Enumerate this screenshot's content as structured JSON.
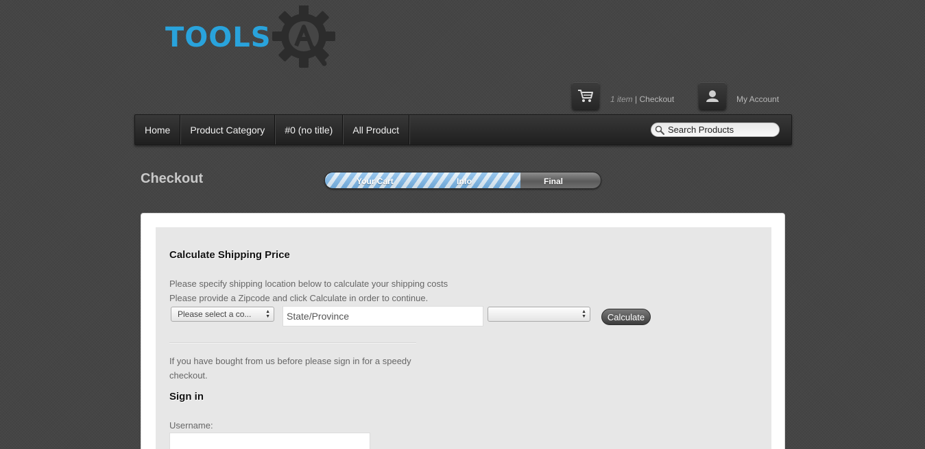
{
  "logo": {
    "text": "TOOLS",
    "badge_letter": "A"
  },
  "header": {
    "cart_count": "1 item",
    "cart_separator": " | ",
    "checkout_link": "Checkout",
    "account_link": "My Account"
  },
  "nav": {
    "items": [
      {
        "label": "Home"
      },
      {
        "label": "Product Category"
      },
      {
        "label": "#0 (no title)"
      },
      {
        "label": "All Product"
      }
    ],
    "search_placeholder": "Search Products"
  },
  "page": {
    "title": "Checkout",
    "progress": {
      "steps": [
        "Your Cart",
        "Info",
        "Final"
      ],
      "fraction_complete": 0.71
    }
  },
  "shipping": {
    "heading": "Calculate Shipping Price",
    "line1": "Please specify shipping location below to calculate your shipping costs",
    "line2": "Please provide a Zipcode and click Calculate in order to continue.",
    "country_select": "Please select a co...",
    "state_placeholder": "State/Province",
    "region_select": "",
    "calculate_button": "Calculate"
  },
  "signin": {
    "intro": "If you have bought from us before please sign in for a speedy checkout.",
    "heading": "Sign in",
    "username_label": "Username:",
    "username_value": ""
  },
  "colors": {
    "accent": "#29a3dc",
    "background": "#454545",
    "progress_stripe": "#78b5e8"
  }
}
